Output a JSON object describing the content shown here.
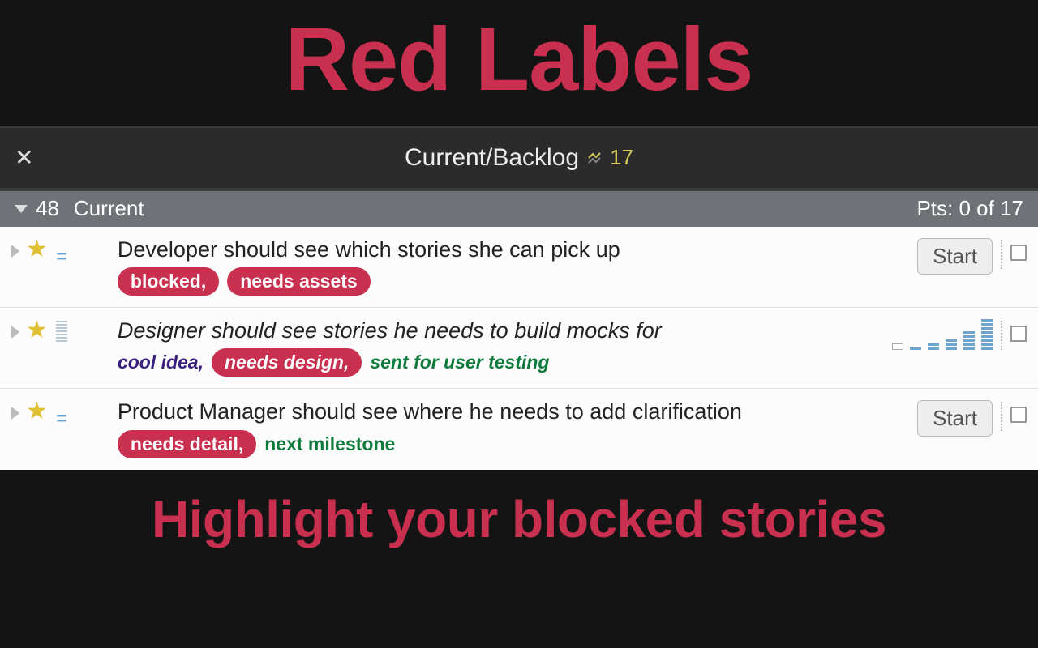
{
  "hero": {
    "title": "Red Labels",
    "subtitle": "Highlight your blocked stories"
  },
  "panel": {
    "title": "Current/Backlog",
    "count": "17"
  },
  "section": {
    "count": "48",
    "title": "Current",
    "points": "Pts: 0 of 17"
  },
  "stories": [
    {
      "title": "Developer should see which stories she can pick up",
      "italic": false,
      "labels": [
        {
          "text": "blocked,",
          "style": "red"
        },
        {
          "text": "needs assets",
          "style": "red"
        }
      ],
      "estimated": true,
      "startable": true
    },
    {
      "title": "Designer should see stories he needs to build mocks for",
      "italic": true,
      "labels": [
        {
          "text": "cool idea,",
          "style": "purple"
        },
        {
          "text": "needs design,",
          "style": "red-italic"
        },
        {
          "text": "sent for user testing",
          "style": "green-italic"
        }
      ],
      "estimated": false,
      "startable": false
    },
    {
      "title": "Product Manager should see where he needs to add clarification",
      "italic": false,
      "labels": [
        {
          "text": "needs detail,",
          "style": "red"
        },
        {
          "text": "next milestone",
          "style": "green"
        }
      ],
      "estimated": true,
      "startable": true
    }
  ],
  "buttons": {
    "start": "Start"
  }
}
